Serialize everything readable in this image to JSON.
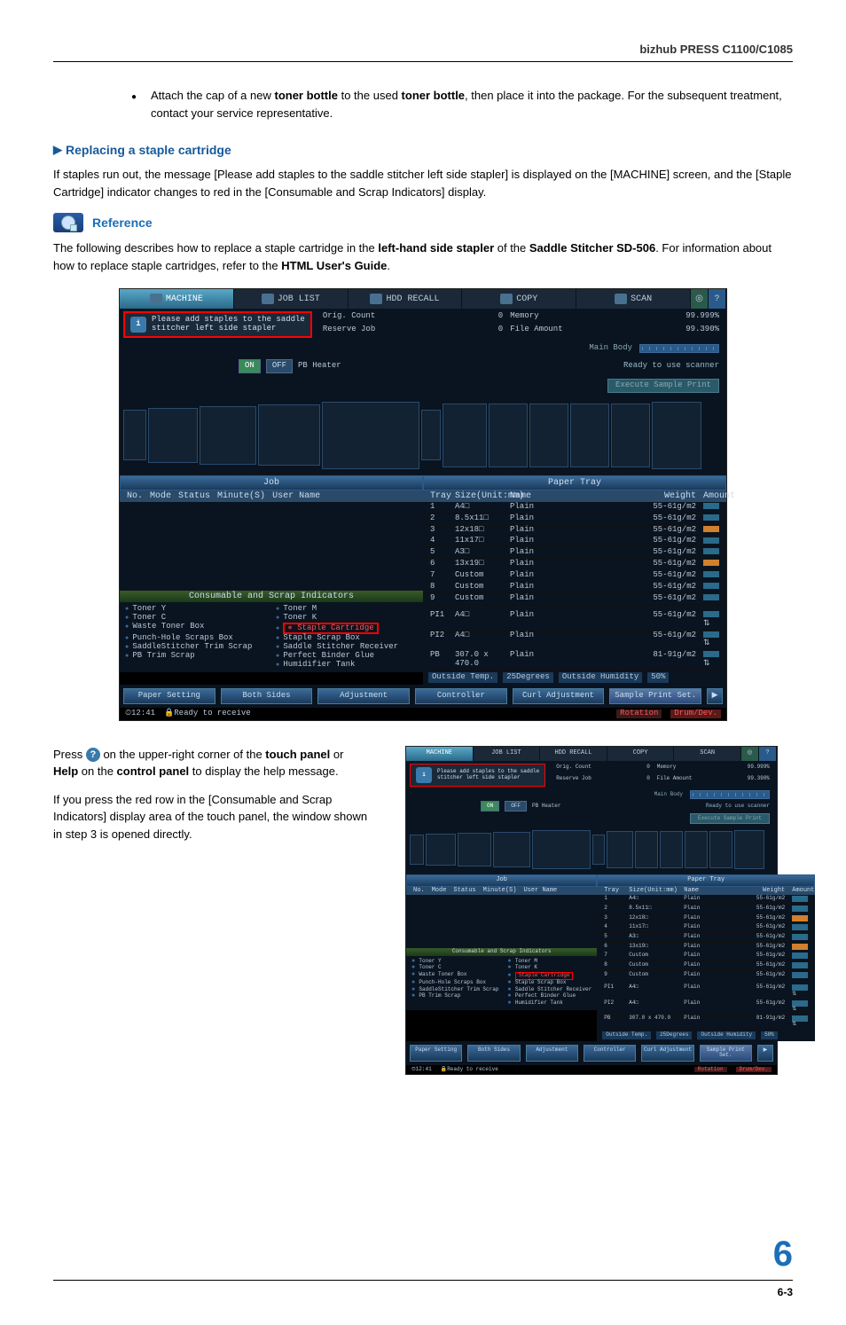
{
  "header": {
    "model": "bizhub PRESS C1100/C1085"
  },
  "body": {
    "bullet": {
      "pre": "Attach the cap of a new ",
      "b1": "toner bottle",
      "mid": " to the used ",
      "b2": "toner bottle",
      "post": ", then place it into the package. For the subsequent treatment, contact your service representative."
    },
    "h_replace": "Replacing a staple cartridge",
    "p_staples": "If staples run out, the message [Please add staples to the saddle stitcher left side stapler] is displayed on the [MACHINE] screen, and the [Staple Cartridge] indicator changes to red in the [Consumable and Scrap Indicators] display.",
    "ref_label": "Reference",
    "ref_para": {
      "pre": "The following describes how to replace a staple cartridge in the ",
      "b1": "left-hand side stapler",
      "mid": " of the ",
      "b2": "Saddle Stitcher SD-506",
      "post": ". For information about how to replace staple cartridges, refer to the ",
      "b3": "HTML User's Guide",
      "end": "."
    },
    "press": {
      "pre": "Press ",
      "icon": "?",
      "mid": " on the upper-right corner of the ",
      "b1": "touch panel",
      "or": " or ",
      "b2": "Help",
      "on": " on the ",
      "b3": "control panel",
      "post": " to display the help message."
    },
    "p_redrow": "If you press the red row in the [Consumable and Scrap Indicators] display area of the touch panel, the window shown in step 3 is opened directly."
  },
  "screen": {
    "tabs": {
      "machine": "MACHINE",
      "joblist": "JOB LIST",
      "recall": "HDD RECALL",
      "copy": "COPY",
      "scan": "SCAN"
    },
    "message": "Please add staples to the saddle\nstitcher left side stapler",
    "stats": {
      "orig": "Orig. Count",
      "origv": "0",
      "reserve": "Reserve Job",
      "reservev": "0",
      "mem": "Memory",
      "memv": "99.999%",
      "file": "File Amount",
      "filev": "99.390%"
    },
    "mainbody": "Main Body",
    "pb": {
      "on": "ON",
      "off": "OFF",
      "label": "PB Heater",
      "ready": "Ready to use scanner",
      "exec": "Execute Sample Print"
    },
    "job_title": "Job",
    "tray_title": "Paper Tray",
    "jobhead": {
      "no": "No.",
      "mode": "Mode",
      "status": "Status",
      "min": "Minute(S)",
      "user": "User Name"
    },
    "trayhead": {
      "tray": "Tray",
      "size": "Size(Unit:mm)",
      "name": "Name",
      "wt": "Weight",
      "amt": "Amount"
    },
    "trays": [
      {
        "no": "1",
        "size": "A4□",
        "name": "Plain",
        "wt": "55-61g/m2",
        "lvl": "mid"
      },
      {
        "no": "2",
        "size": "8.5x11□",
        "name": "Plain",
        "wt": "55-61g/m2",
        "lvl": "mid"
      },
      {
        "no": "3",
        "size": "12x18□",
        "name": "Plain",
        "wt": "55-61g/m2",
        "lvl": "low"
      },
      {
        "no": "4",
        "size": "11x17□",
        "name": "Plain",
        "wt": "55-61g/m2",
        "lvl": "mid"
      },
      {
        "no": "5",
        "size": "A3□",
        "name": "Plain",
        "wt": "55-61g/m2",
        "lvl": "mid"
      },
      {
        "no": "6",
        "size": "13x19□",
        "name": "Plain",
        "wt": "55-61g/m2",
        "lvl": "low"
      },
      {
        "no": "7",
        "size": "Custom",
        "name": "Plain",
        "wt": "55-61g/m2",
        "lvl": "mid"
      },
      {
        "no": "8",
        "size": "Custom",
        "name": "Plain",
        "wt": "55-61g/m2",
        "lvl": "mid"
      },
      {
        "no": "9",
        "size": "Custom",
        "name": "Plain",
        "wt": "55-61g/m2",
        "lvl": "mid"
      }
    ],
    "pi": [
      {
        "no": "PI1",
        "size": "A4□",
        "name": "Plain",
        "wt": "55-61g/m2"
      },
      {
        "no": "PI2",
        "size": "A4□",
        "name": "Plain",
        "wt": "55-61g/m2"
      },
      {
        "no": "PB",
        "size": "307.0 x 470.0",
        "name": "Plain",
        "wt": "81-91g/m2"
      }
    ],
    "consum_title": "Consumable and Scrap Indicators",
    "consum": {
      "l1": "Toner Y",
      "r1": "Toner M",
      "l2": "Toner C",
      "r2": "Toner K",
      "l3": "Waste Toner Box",
      "r3": "Staple Cartridge",
      "l4": "Punch-Hole Scraps Box",
      "r4": "Staple Scrap Box",
      "l5": "SaddleStitcher Trim Scrap",
      "r5": "Saddle Stitcher Receiver",
      "l6": "PB Trim Scrap",
      "r6": "Perfect Binder Glue",
      "r7": "Humidifier Tank"
    },
    "env": {
      "ot": "Outside Temp.",
      "otv": "25Degrees",
      "oh": "Outside Humidity",
      "ohv": "50%"
    },
    "buttons": {
      "ps": "Paper Setting",
      "bs": "Both Sides",
      "adj": "Adjustment",
      "ctrl": "Controller",
      "curl": "Curl Adjustment",
      "sample": "Sample Print Set."
    },
    "footer": {
      "time": "12:41",
      "ready": "Ready to receive",
      "rot": "Rotation",
      "drum": "Drum/Dev."
    }
  },
  "pagenum": "6",
  "footpg": "6-3"
}
